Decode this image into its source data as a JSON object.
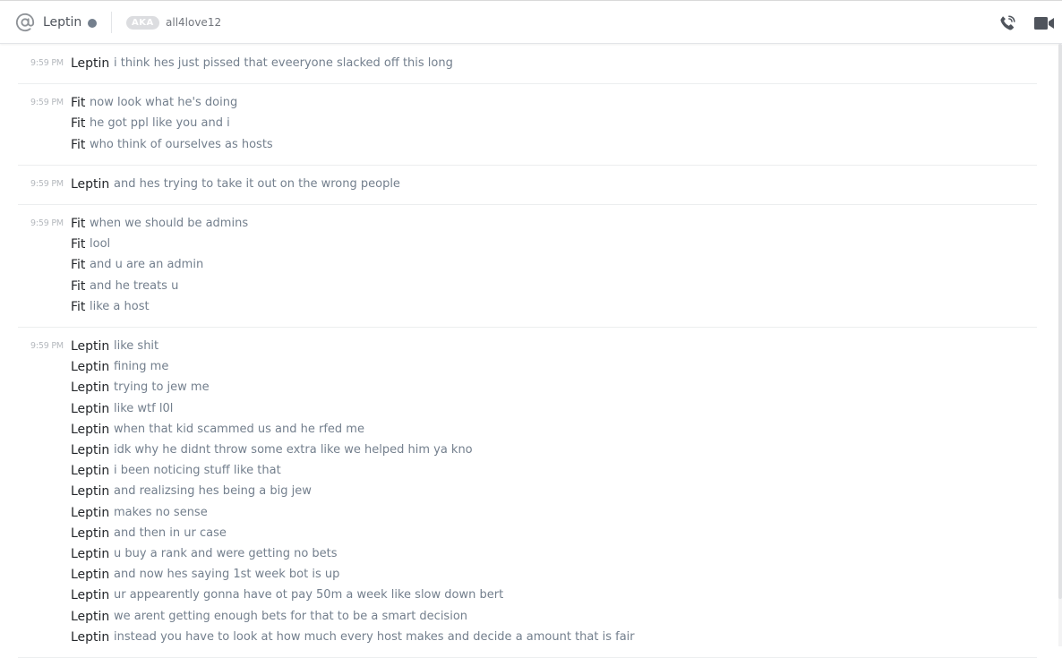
{
  "header": {
    "channel_name": "Leptin",
    "aka_label": "AKA",
    "aka_value": "all4love12",
    "status": "offline",
    "icons": [
      "at-icon",
      "phone-call-icon",
      "video-call-icon"
    ]
  },
  "groups": [
    {
      "timestamp": "9:59 PM",
      "messages": [
        {
          "author": "Leptin",
          "text": "i think hes just pissed that eveeryone slacked off this long"
        }
      ]
    },
    {
      "timestamp": "9:59 PM",
      "messages": [
        {
          "author": "Fit",
          "text": "now look what he's doing"
        },
        {
          "author": "Fit",
          "text": "he got ppl like you and i"
        },
        {
          "author": "Fit",
          "text": "who think of ourselves as hosts"
        }
      ]
    },
    {
      "timestamp": "9:59 PM",
      "messages": [
        {
          "author": "Leptin",
          "text": "and hes trying to take it out on the wrong people"
        }
      ]
    },
    {
      "timestamp": "9:59 PM",
      "messages": [
        {
          "author": "Fit",
          "text": "when we should be admins"
        },
        {
          "author": "Fit",
          "text": "lool"
        },
        {
          "author": "Fit",
          "text": "and u are an admin"
        },
        {
          "author": "Fit",
          "text": "and he treats u"
        },
        {
          "author": "Fit",
          "text": "like a host"
        }
      ]
    },
    {
      "timestamp": "9:59 PM",
      "messages": [
        {
          "author": "Leptin",
          "text": "like shit"
        },
        {
          "author": "Leptin",
          "text": "fining me"
        },
        {
          "author": "Leptin",
          "text": "trying to jew me"
        },
        {
          "author": "Leptin",
          "text": "like wtf l0l"
        },
        {
          "author": "Leptin",
          "text": "when that kid scammed us and he rfed me"
        },
        {
          "author": "Leptin",
          "text": "idk why he didnt throw some extra like we helped him ya kno"
        },
        {
          "author": "Leptin",
          "text": "i been noticing stuff like that"
        },
        {
          "author": "Leptin",
          "text": "and realizsing hes being a big jew"
        },
        {
          "author": "Leptin",
          "text": "makes no sense"
        },
        {
          "author": "Leptin",
          "text": "and then in ur case"
        },
        {
          "author": "Leptin",
          "text": "u buy a rank and were getting no bets"
        },
        {
          "author": "Leptin",
          "text": "and now hes saying 1st week bot is up"
        },
        {
          "author": "Leptin",
          "text": "ur appearently gonna have ot pay 50m a week like slow down bert"
        },
        {
          "author": "Leptin",
          "text": "we arent getting enough bets for that to be a smart decision"
        },
        {
          "author": "Leptin",
          "text": "instead you have to look at how much every host makes and decide a amount that is fair"
        }
      ]
    }
  ]
}
